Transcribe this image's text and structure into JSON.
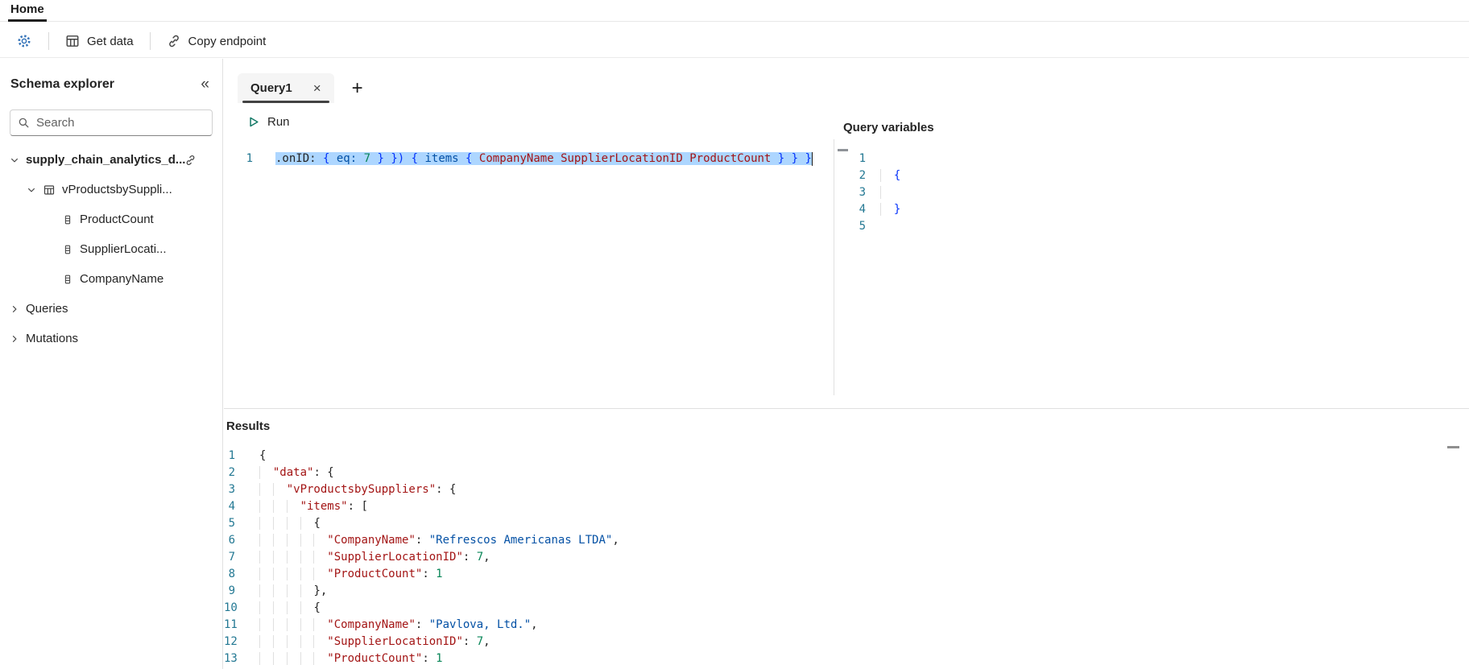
{
  "header": {
    "home_tab": "Home"
  },
  "toolbar": {
    "get_data": "Get data",
    "copy_endpoint": "Copy endpoint"
  },
  "icons": {
    "settings": "gear-icon",
    "get_data": "table-grid-icon",
    "copy_endpoint": "link-icon",
    "search": "magnifier-icon",
    "collapse_panel": "double-chevron-left-icon",
    "run": "play-outline-icon",
    "close_tab": "x-icon",
    "new_tab": "plus-icon"
  },
  "sidebar": {
    "title": "Schema explorer",
    "search_placeholder": "Search",
    "tree": [
      {
        "label": "supply_chain_analytics_d...",
        "type": "root",
        "chevron": "down",
        "trailing": "link",
        "bold": true
      },
      {
        "label": "vProductsbySuppli...",
        "type": "table",
        "chevron": "down",
        "icon": "table"
      },
      {
        "label": "ProductCount",
        "type": "column",
        "icon": "column"
      },
      {
        "label": "SupplierLocati...",
        "type": "column",
        "icon": "column"
      },
      {
        "label": "CompanyName",
        "type": "column",
        "icon": "column"
      },
      {
        "label": "Queries",
        "type": "section",
        "chevron": "right"
      },
      {
        "label": "Mutations",
        "type": "section",
        "chevron": "right"
      }
    ]
  },
  "main": {
    "tab_label": "Query1",
    "run_label": "Run",
    "query_variables_title": "Query variables",
    "results_title": "Results"
  },
  "colors": {
    "accent_gear": "#3674b9",
    "run_play": "#117865",
    "selection": "#add6ff",
    "line_number": "#237893",
    "tok_fg": "#242424",
    "tok_key": "#a31515",
    "tok_str": "#0451a5",
    "tok_num": "#098658",
    "tok_brace": "#0431fa",
    "tok_attr": "#0451a5",
    "tok_field": "#a31515"
  },
  "query_editor": {
    "lines": [
      {
        "num": "1",
        "selected": true,
        "tokens": [
          [
            ".onID: ",
            "fg"
          ],
          [
            "{ ",
            "brace"
          ],
          [
            "eq: ",
            "attr"
          ],
          [
            "7 ",
            "num"
          ],
          [
            "} ",
            "brace"
          ],
          [
            "}) ",
            "brace"
          ],
          [
            "{ ",
            "brace"
          ],
          [
            "items ",
            "attr"
          ],
          [
            "{ ",
            "brace"
          ],
          [
            "CompanyName ",
            "field"
          ],
          [
            "SupplierLocationID ",
            "field"
          ],
          [
            "ProductCount ",
            "field"
          ],
          [
            "} } }",
            "brace"
          ]
        ]
      }
    ]
  },
  "variables_editor": {
    "lines": [
      {
        "num": "1",
        "indent": 0,
        "tokens": []
      },
      {
        "num": "2",
        "indent": 1,
        "tokens": [
          [
            "{",
            "brace"
          ]
        ]
      },
      {
        "num": "3",
        "indent": 1,
        "tokens": []
      },
      {
        "num": "4",
        "indent": 1,
        "tokens": [
          [
            "}",
            "brace"
          ]
        ]
      },
      {
        "num": "5",
        "indent": 0,
        "tokens": []
      }
    ]
  },
  "results_editor": {
    "lines": [
      {
        "num": "1",
        "indent": 0,
        "tokens": [
          [
            "{",
            "punct"
          ]
        ]
      },
      {
        "num": "2",
        "indent": 1,
        "tokens": [
          [
            "\"data\"",
            "key"
          ],
          [
            ": ",
            "punct"
          ],
          [
            "{",
            "punct"
          ]
        ]
      },
      {
        "num": "3",
        "indent": 2,
        "tokens": [
          [
            "\"vProductsbySuppliers\"",
            "key"
          ],
          [
            ": ",
            "punct"
          ],
          [
            "{",
            "punct"
          ]
        ]
      },
      {
        "num": "4",
        "indent": 3,
        "tokens": [
          [
            "\"items\"",
            "key"
          ],
          [
            ": ",
            "punct"
          ],
          [
            "[",
            "punct"
          ]
        ]
      },
      {
        "num": "5",
        "indent": 4,
        "tokens": [
          [
            "{",
            "punct"
          ]
        ]
      },
      {
        "num": "6",
        "indent": 5,
        "tokens": [
          [
            "\"CompanyName\"",
            "key"
          ],
          [
            ": ",
            "punct"
          ],
          [
            "\"Refrescos Americanas LTDA\"",
            "str"
          ],
          [
            ",",
            "punct"
          ]
        ]
      },
      {
        "num": "7",
        "indent": 5,
        "tokens": [
          [
            "\"SupplierLocationID\"",
            "key"
          ],
          [
            ": ",
            "punct"
          ],
          [
            "7",
            "num"
          ],
          [
            ",",
            "punct"
          ]
        ]
      },
      {
        "num": "8",
        "indent": 5,
        "tokens": [
          [
            "\"ProductCount\"",
            "key"
          ],
          [
            ": ",
            "punct"
          ],
          [
            "1",
            "num"
          ]
        ]
      },
      {
        "num": "9",
        "indent": 4,
        "tokens": [
          [
            "}",
            "punct"
          ],
          [
            ",",
            "punct"
          ]
        ]
      },
      {
        "num": "10",
        "indent": 4,
        "tokens": [
          [
            "{",
            "punct"
          ]
        ]
      },
      {
        "num": "11",
        "indent": 5,
        "tokens": [
          [
            "\"CompanyName\"",
            "key"
          ],
          [
            ": ",
            "punct"
          ],
          [
            "\"Pavlova, Ltd.\"",
            "str"
          ],
          [
            ",",
            "punct"
          ]
        ]
      },
      {
        "num": "12",
        "indent": 5,
        "tokens": [
          [
            "\"SupplierLocationID\"",
            "key"
          ],
          [
            ": ",
            "punct"
          ],
          [
            "7",
            "num"
          ],
          [
            ",",
            "punct"
          ]
        ]
      },
      {
        "num": "13",
        "indent": 5,
        "tokens": [
          [
            "\"ProductCount\"",
            "key"
          ],
          [
            ": ",
            "punct"
          ],
          [
            "1",
            "num"
          ]
        ]
      }
    ]
  }
}
